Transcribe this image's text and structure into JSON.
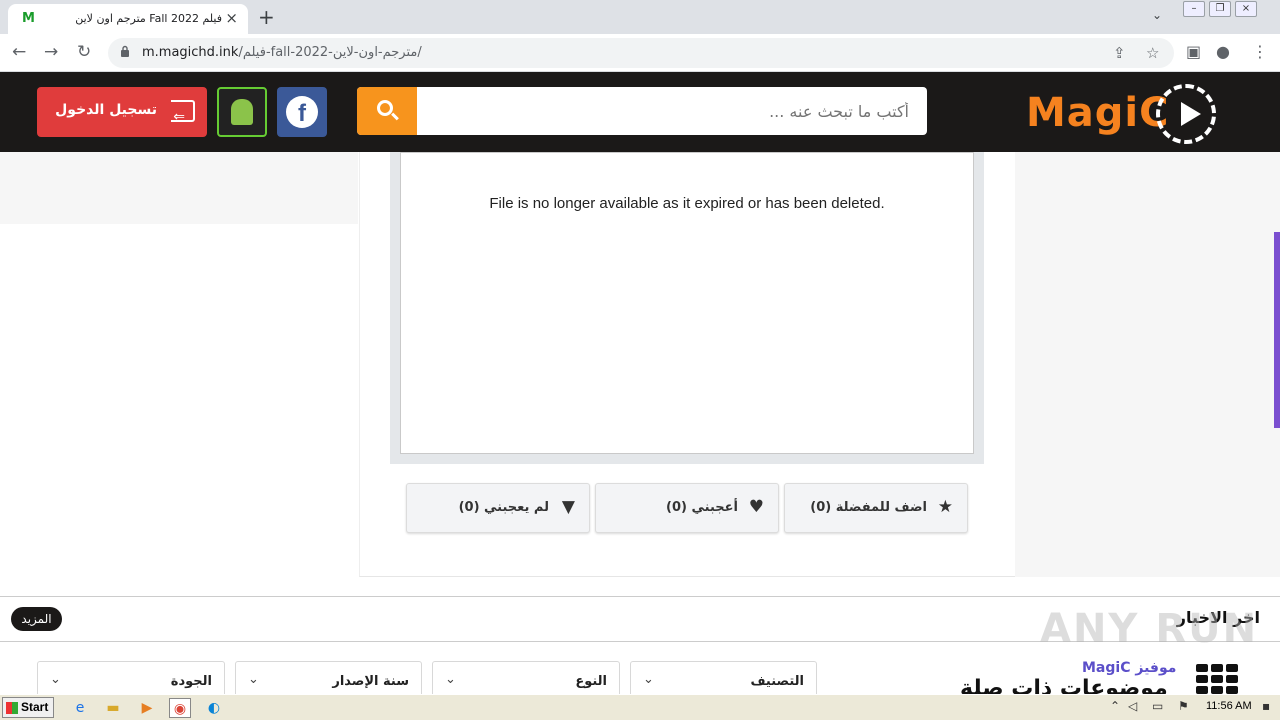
{
  "browser": {
    "tab_title": "فيلم Fall 2022 مترجم اون لاين",
    "tab_favicon": "M",
    "url_host": "m.magichd.ink",
    "url_path": "/فيلم-fall-2022-مترجم-اون-لاين/"
  },
  "header": {
    "logo_text": "MagiC",
    "search_placeholder": "أكتب ما تبحث عنه ...",
    "facebook_glyph": "f",
    "login_label": "تسجيل الدخول"
  },
  "player": {
    "message": "File is no longer available as it expired or has been deleted."
  },
  "actions": {
    "favorite": "اضف للمفضلة (0)",
    "like": "أعجبني (0)",
    "dislike": "لم يعجبني (0)"
  },
  "news": {
    "title": "اخر الاخبار",
    "more": "المزيد"
  },
  "watermark": "ANY RUN",
  "filters": {
    "classification": "التصنيف",
    "genre": "النوع",
    "year": "سنة الإصدار",
    "quality": "الجودة"
  },
  "related": {
    "brand": "موفيز MagiC",
    "title": "موضوعات ذات صلة"
  },
  "taskbar": {
    "start": "Start",
    "clock": "11:56 AM"
  },
  "colors": {
    "accent_orange": "#f7941d",
    "header_bg": "#1b1918",
    "login_red": "#e03c3c",
    "facebook_blue": "#3b5998"
  }
}
